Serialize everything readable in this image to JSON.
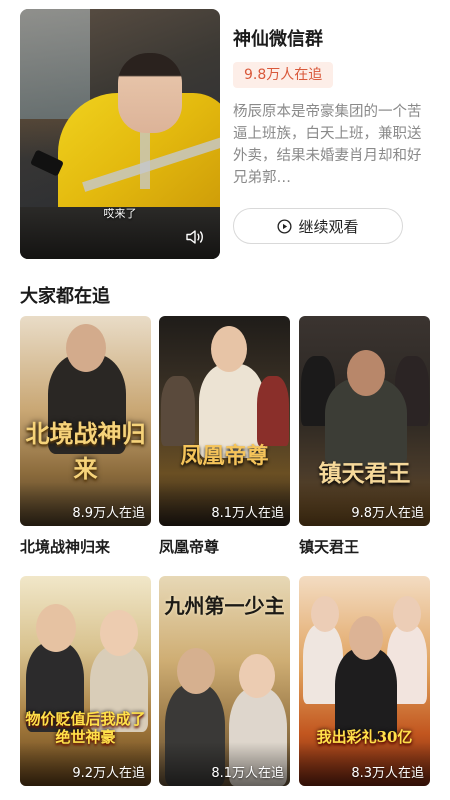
{
  "featured": {
    "title": "神仙微信群",
    "badge": "9.8万人在追",
    "description": "杨辰原本是帝豪集团的一个苦逼上班族，白天上班，兼职送外卖，结果未婚妻肖月却和好兄弟郭…",
    "subtitle": "哎来了",
    "button_label": "继续观看",
    "accent_color": "#d9583a"
  },
  "section": {
    "title": "大家都在追"
  },
  "dramas": [
    {
      "title": "北境战神归来",
      "count": "8.9万人在追",
      "poster_text": "北境战神归来"
    },
    {
      "title": "凤凰帝尊",
      "count": "8.1万人在追",
      "poster_text": "凤凰帝尊"
    },
    {
      "title": "镇天君王",
      "count": "9.8万人在追",
      "poster_text": "镇天君王"
    },
    {
      "title": "",
      "count": "9.2万人在追",
      "poster_text": "物价贬值后我成了绝世神豪"
    },
    {
      "title": "",
      "count": "8.1万人在追",
      "poster_text": "九州第一少主"
    },
    {
      "title": "",
      "count": "8.3万人在追",
      "poster_text": "我出彩礼30亿"
    }
  ],
  "icons": {
    "play": "play-circle-icon",
    "volume": "volume-icon"
  }
}
